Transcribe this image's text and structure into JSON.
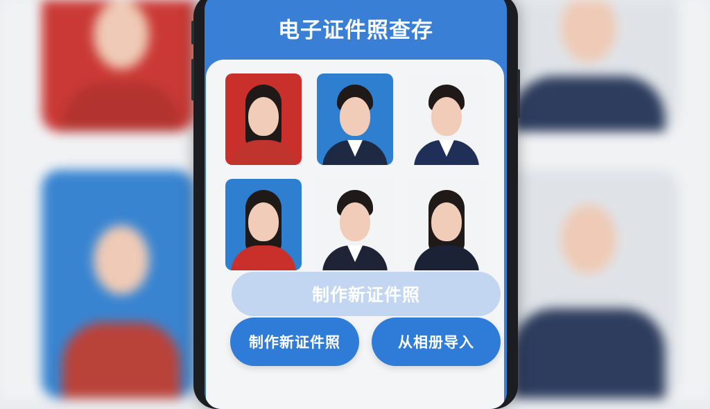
{
  "app": {
    "title": "电子证件照查存"
  },
  "photos": [
    {
      "bg": "#c9302c",
      "type": "woman",
      "outfit": "#c0342e"
    },
    {
      "bg": "#2f7fd0",
      "type": "man-glasses",
      "outfit": "#1e2a44"
    },
    {
      "bg": "#f3f4f6",
      "type": "man",
      "outfit": "#1f2f57"
    },
    {
      "bg": "#2f7fd0",
      "type": "woman",
      "outfit": "#c9302c"
    },
    {
      "bg": "#f3f4f6",
      "type": "man-older",
      "outfit": "#1e2436"
    },
    {
      "bg": "#f3f4f6",
      "type": "woman",
      "outfit": "#1b2236"
    }
  ],
  "overlay": {
    "label": "制作新证件照"
  },
  "buttons": {
    "make_new": "制作新证件照",
    "import_album": "从相册导入"
  },
  "colors": {
    "accent": "#2f7bd8",
    "header": "#3a7fd6"
  }
}
